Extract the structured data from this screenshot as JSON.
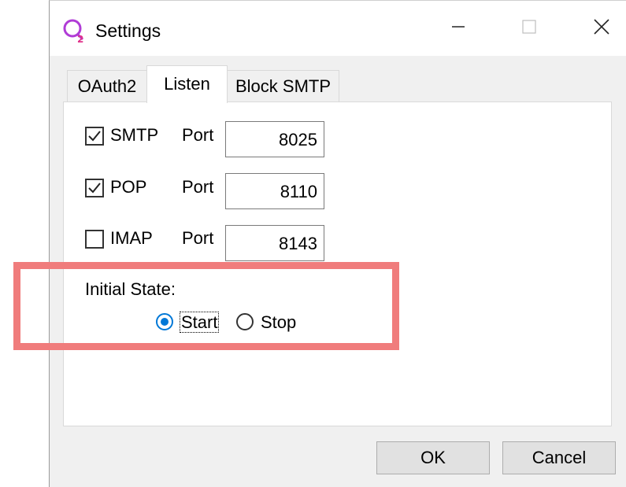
{
  "window": {
    "title": "Settings",
    "app_icon": "o2-logo-icon",
    "controls": [
      "minimize-icon",
      "maximize-icon",
      "close-icon"
    ]
  },
  "tabs": [
    {
      "label": "OAuth2",
      "active": false
    },
    {
      "label": "Listen",
      "active": true
    },
    {
      "label": "Block SMTP",
      "active": false
    }
  ],
  "listen": {
    "protocols": [
      {
        "label": "SMTP",
        "checked": true,
        "port_label": "Port",
        "port_value": "8025"
      },
      {
        "label": "POP",
        "checked": true,
        "port_label": "Port",
        "port_value": "8110"
      },
      {
        "label": "IMAP",
        "checked": false,
        "port_label": "Port",
        "port_value": "8143"
      }
    ],
    "initial_state": {
      "label": "Initial State:",
      "options": [
        {
          "label": "Start",
          "selected": true
        },
        {
          "label": "Stop",
          "selected": false
        }
      ]
    }
  },
  "buttons": {
    "ok": "OK",
    "cancel": "Cancel"
  },
  "colors": {
    "highlight": "#f07c7c",
    "radio_accent": "#0078d7",
    "app_icon_purple": "#b03cd6"
  }
}
